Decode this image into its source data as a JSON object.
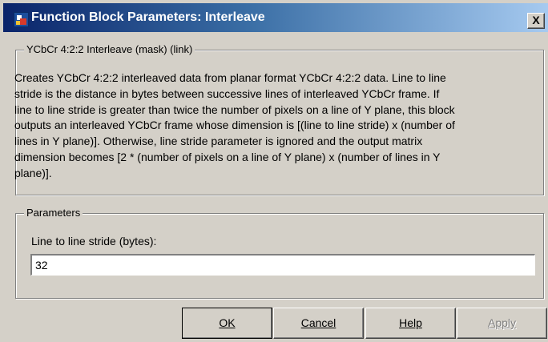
{
  "window": {
    "title": "Function Block Parameters: Interleave",
    "close_glyph": "X"
  },
  "description_group": {
    "legend": "YCbCr 4:2:2 Interleave (mask) (link)",
    "lines": [
      "Creates YCbCr 4:2:2 interleaved data from planar format YCbCr 4:2:2 data. Line to line",
      "stride is the distance in bytes between successive lines of interleaved YCbCr frame. If",
      "line to line stride is greater than twice the number of pixels on a line of Y plane, this block",
      "outputs an interleaved YCbCr frame whose dimension is [(line to line stride) x (number of",
      "lines in Y plane)]. Otherwise, line stride parameter is ignored and the output matrix",
      "dimension becomes [2 * (number of pixels on a line of Y plane) x (number of lines in Y",
      "plane)]."
    ]
  },
  "parameters_group": {
    "legend": "Parameters",
    "field_label": "Line to line stride (bytes):",
    "field_value": "32"
  },
  "buttons": {
    "ok": "OK",
    "cancel": "Cancel",
    "help": "Help",
    "apply": "Apply"
  },
  "icons": {
    "app": "simulink-block-icon",
    "close": "close-icon"
  }
}
